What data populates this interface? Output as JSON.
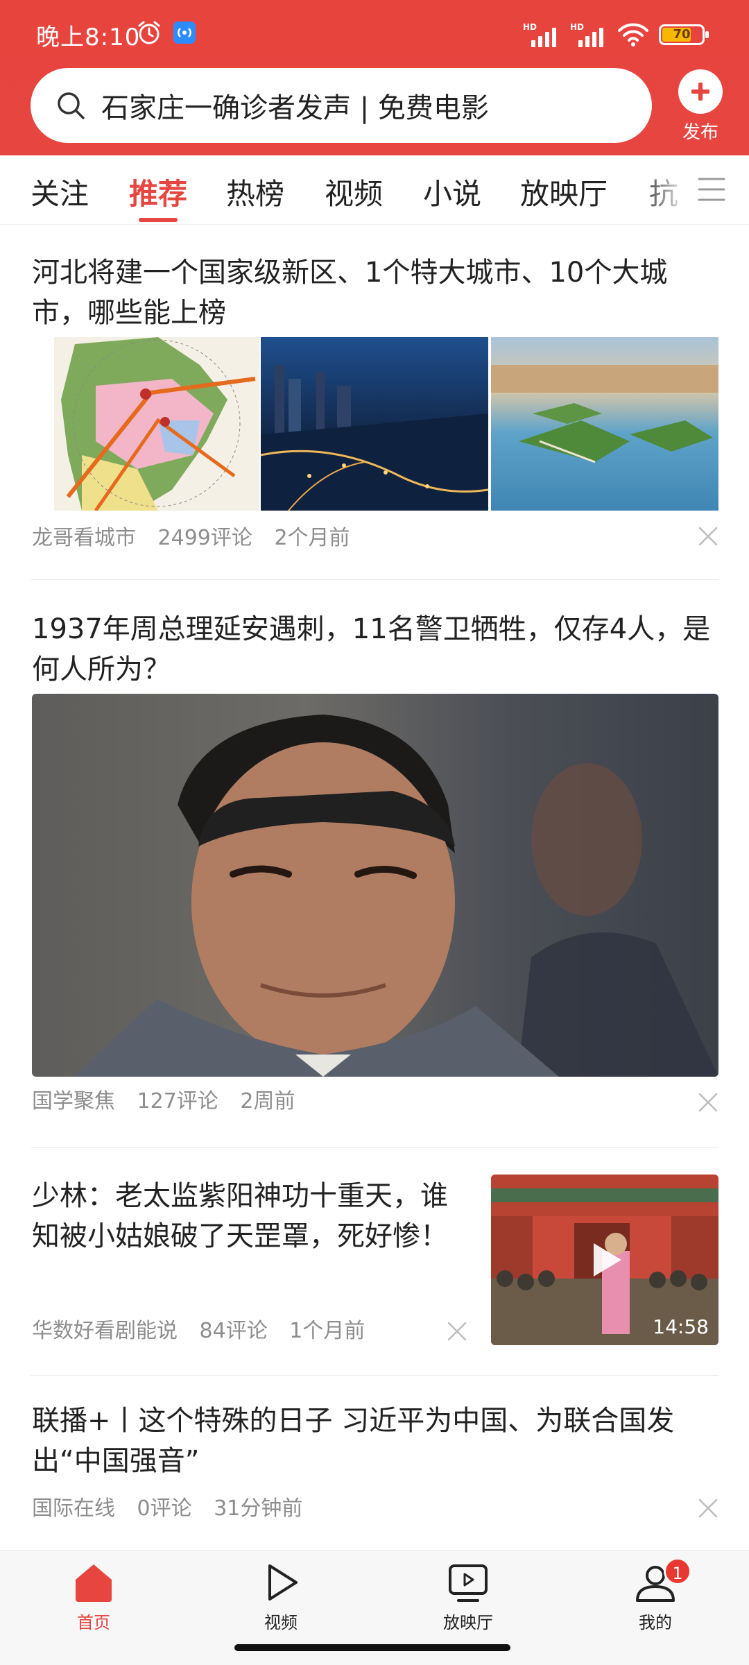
{
  "status_bar": {
    "time": "晚上8:10",
    "signal_label": "HD",
    "battery_level": "70"
  },
  "search": {
    "query": "石家庄一确诊者发声 | 免费电影",
    "publish_label": "发布"
  },
  "tabs": [
    {
      "label": "关注",
      "active": false
    },
    {
      "label": "推荐",
      "active": true
    },
    {
      "label": "热榜",
      "active": false
    },
    {
      "label": "视频",
      "active": false
    },
    {
      "label": "小说",
      "active": false
    },
    {
      "label": "放映厅",
      "active": false
    },
    {
      "label": "抗",
      "active": false
    }
  ],
  "articles": [
    {
      "title": "河北将建一个国家级新区、1个特大城市、10个大城市，哪些能上榜",
      "source": "龙哥看城市",
      "comments": "2499评论",
      "time": "2个月前",
      "images": [
        "region-map-image",
        "city-night-image",
        "lake-island-image"
      ]
    },
    {
      "title": "1937年周总理延安遇刺，11名警卫牺牲，仅存4人，是何人所为？",
      "source": "国学聚焦",
      "comments": "127评论",
      "time": "2周前",
      "images": [
        "portrait-photo-image"
      ]
    },
    {
      "title": "少林：老太监紫阳神功十重天，谁知被小姑娘破了天罡罩，死好惨！",
      "source": "华数好看剧能说",
      "comments": "84评论",
      "time": "1个月前",
      "video_duration": "14:58"
    },
    {
      "title": "联播+丨这个特殊的日子 习近平为中国、为联合国发出“中国强音”",
      "source": "国际在线",
      "comments": "0评论",
      "time": "31分钟前"
    }
  ],
  "bottom_nav": [
    {
      "label": "首页",
      "icon": "home-icon",
      "active": true
    },
    {
      "label": "视频",
      "icon": "video-play-icon",
      "active": false
    },
    {
      "label": "放映厅",
      "icon": "theater-icon",
      "active": false
    },
    {
      "label": "我的",
      "icon": "profile-icon",
      "active": false,
      "badge": "1"
    }
  ],
  "colors": {
    "brand_red": "#e64540",
    "meta_gray": "#8d8d8d"
  }
}
